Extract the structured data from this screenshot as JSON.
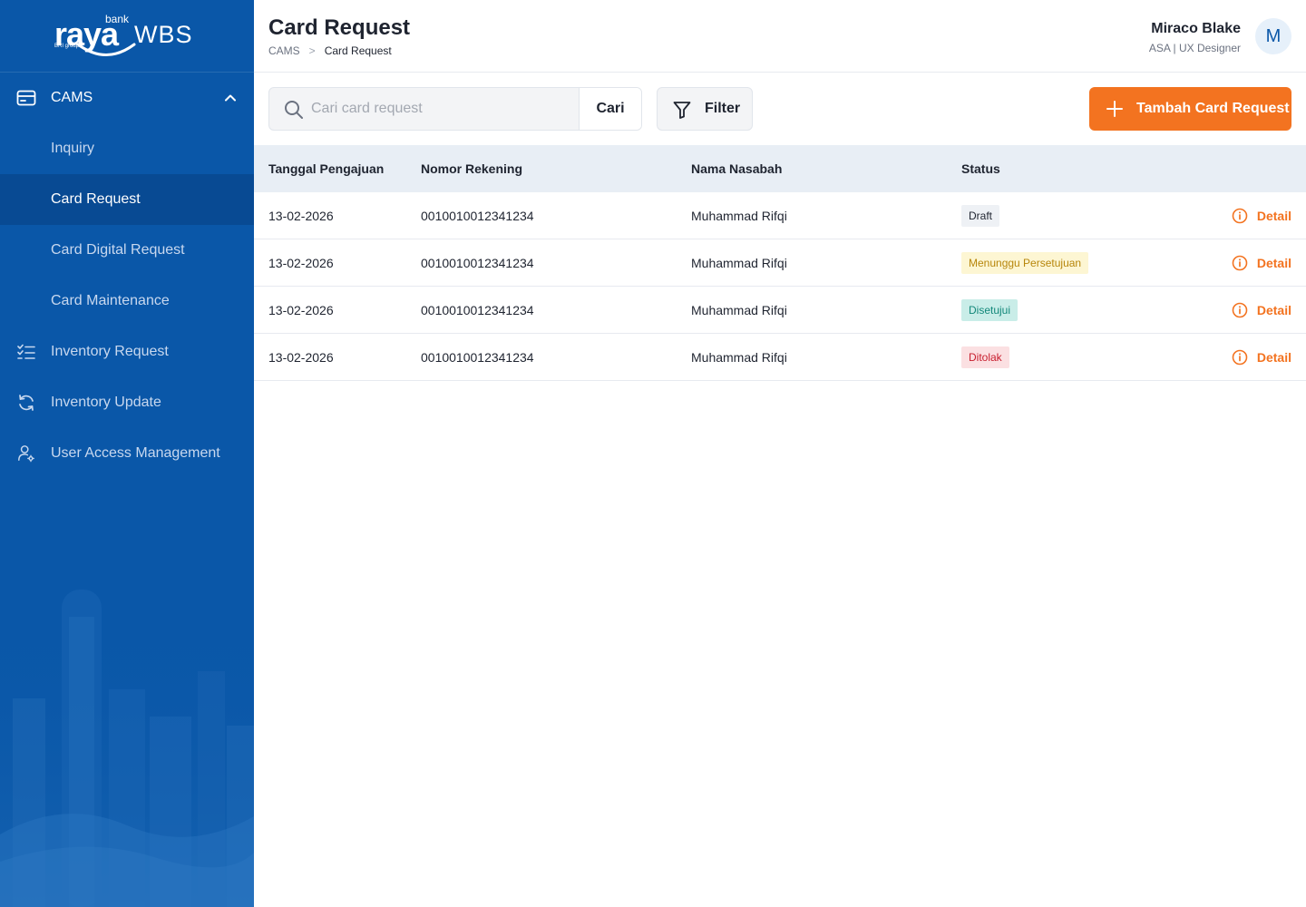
{
  "brand": {
    "bank_word": "bank",
    "raya_word": "raya",
    "wbs_word": "WBS",
    "group_word": "BRI group"
  },
  "sidebar": {
    "parent": {
      "label": "CAMS",
      "icon": "card-icon",
      "expanded": true
    },
    "sub_items": [
      {
        "label": "Inquiry",
        "active": false
      },
      {
        "label": "Card Request",
        "active": true
      },
      {
        "label": "Card Digital Request",
        "active": false
      },
      {
        "label": "Card Maintenance",
        "active": false
      }
    ],
    "items": [
      {
        "label": "Inventory Request",
        "icon": "checklist-icon"
      },
      {
        "label": "Inventory Update",
        "icon": "refresh-icon"
      },
      {
        "label": "User Access Management",
        "icon": "user-gear-icon"
      }
    ]
  },
  "header": {
    "title": "Card Request",
    "breadcrumb": [
      "CAMS",
      "Card Request"
    ],
    "breadcrumb_separator": ">",
    "user": {
      "name": "Miraco Blake",
      "role": "ASA | UX Designer",
      "initial": "M"
    }
  },
  "toolbar": {
    "search_placeholder": "Cari card request",
    "search_value": "",
    "search_button": "Cari",
    "filter_button": "Filter",
    "add_button": "Tambah Card Request"
  },
  "table": {
    "columns": [
      "Tanggal Pengajuan",
      "Nomor Rekening",
      "Nama Nasabah",
      "Status"
    ],
    "detail_label": "Detail",
    "rows": [
      {
        "date": "13-02-2026",
        "account": "0010010012341234",
        "name": "Muhammad Rifqi",
        "status": "Draft",
        "status_bg": "#eef1f5",
        "status_color": "#1f2430"
      },
      {
        "date": "13-02-2026",
        "account": "0010010012341234",
        "name": "Muhammad Rifqi",
        "status": "Menunggu Persetujuan",
        "status_bg": "#fdf6d3",
        "status_color": "#b7860b"
      },
      {
        "date": "13-02-2026",
        "account": "0010010012341234",
        "name": "Muhammad Rifqi",
        "status": "Disetujui",
        "status_bg": "#c9ede8",
        "status_color": "#13887a"
      },
      {
        "date": "13-02-2026",
        "account": "0010010012341234",
        "name": "Muhammad Rifqi",
        "status": "Ditolak",
        "status_bg": "#fbe0e2",
        "status_color": "#c81e2e"
      }
    ]
  },
  "colors": {
    "sidebar_bg": "#0a57a8",
    "sidebar_active_bg": "#084a93",
    "accent": "#f37320",
    "table_header_bg": "#e8eef5"
  }
}
